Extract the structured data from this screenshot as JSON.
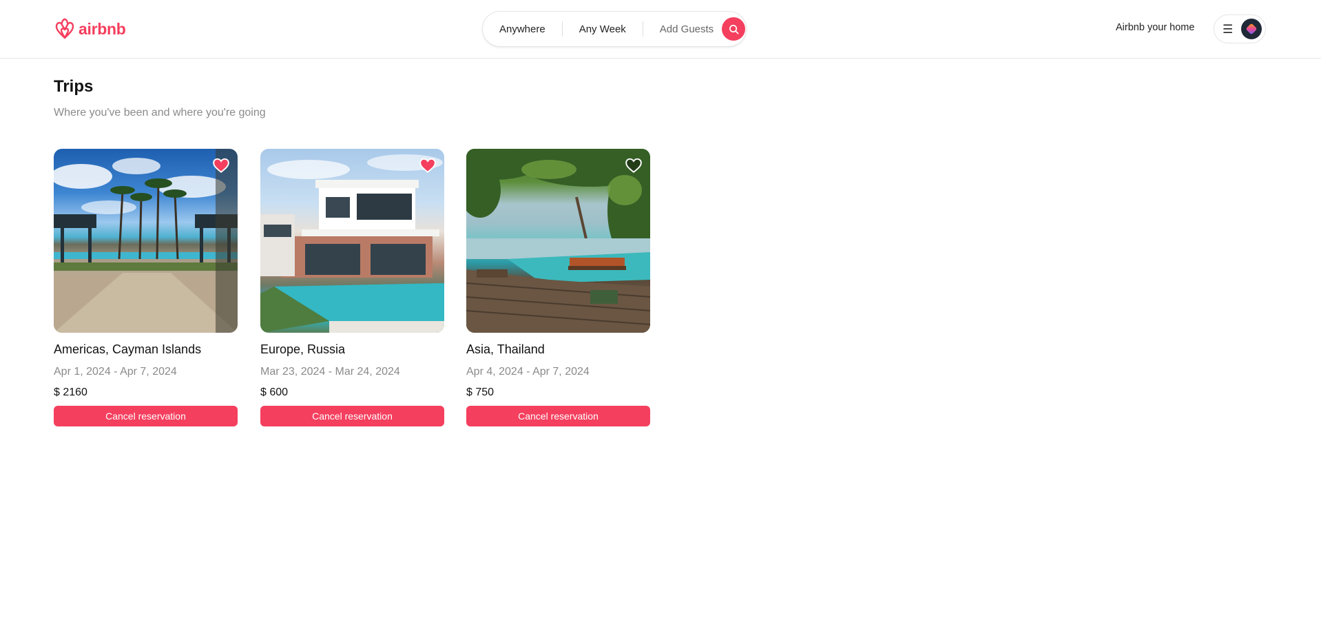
{
  "brand": {
    "name": "airbnb",
    "color": "#f43f5e",
    "icon": "airbnb-logo-icon"
  },
  "search": {
    "location": "Anywhere",
    "dates": "Any Week",
    "guests": "Add Guests",
    "icon": "search-icon"
  },
  "nav": {
    "host_link": "Airbnb your home",
    "menu_icon": "hamburger-icon",
    "avatar_icon": "avatar"
  },
  "page": {
    "title": "Trips",
    "subtitle": "Where you've been and where you're going"
  },
  "trips": [
    {
      "location": "Americas, Cayman Islands",
      "dates": "Apr 1, 2024 - Apr 7, 2024",
      "price": "$ 2160",
      "favorited": true,
      "action": "Cancel reservation"
    },
    {
      "location": "Europe, Russia",
      "dates": "Mar 23, 2024 - Mar 24, 2024",
      "price": "$ 600",
      "favorited": true,
      "action": "Cancel reservation"
    },
    {
      "location": "Asia, Thailand",
      "dates": "Apr 4, 2024 - Apr 7, 2024",
      "price": "$ 750",
      "favorited": false,
      "action": "Cancel reservation"
    }
  ],
  "colors": {
    "accent": "#f43f5e",
    "muted_text": "#8a8a8a",
    "border": "#e6e6e6"
  }
}
